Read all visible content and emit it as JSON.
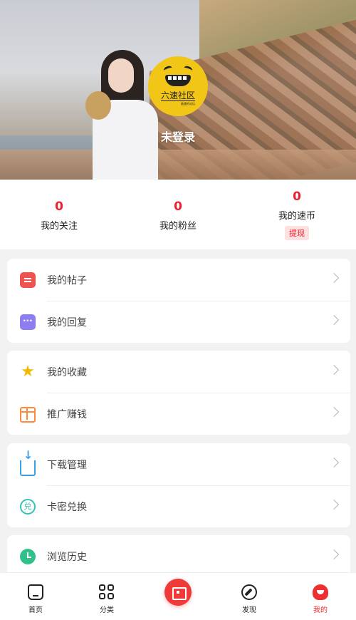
{
  "header": {
    "logo_text": "六速社区",
    "logo_subtext": "极速的论坛",
    "login_status": "未登录"
  },
  "stats": [
    {
      "value": "0",
      "label": "我的关注"
    },
    {
      "value": "0",
      "label": "我的粉丝"
    },
    {
      "value": "0",
      "label": "我的速币",
      "action": "提现"
    }
  ],
  "menu": {
    "group1": [
      {
        "label": "我的帖子",
        "icon": "post-icon"
      },
      {
        "label": "我的回复",
        "icon": "reply-icon"
      }
    ],
    "group2": [
      {
        "label": "我的收藏",
        "icon": "star-icon"
      },
      {
        "label": "推广赚钱",
        "icon": "gift-icon"
      }
    ],
    "group3": [
      {
        "label": "下载管理",
        "icon": "download-icon"
      },
      {
        "label": "卡密兑换",
        "icon": "redeem-icon",
        "glyph": "兑"
      }
    ],
    "group4": [
      {
        "label": "浏览历史",
        "icon": "history-icon"
      }
    ]
  },
  "tabbar": [
    {
      "label": "首页",
      "icon": "home-icon"
    },
    {
      "label": "分类",
      "icon": "category-icon"
    },
    {
      "label": "",
      "icon": "post-center-icon"
    },
    {
      "label": "发现",
      "icon": "compass-icon"
    },
    {
      "label": "我的",
      "icon": "profile-icon",
      "active": true
    }
  ],
  "colors": {
    "accent": "#ee1f2e",
    "background": "#f2f2f2"
  }
}
